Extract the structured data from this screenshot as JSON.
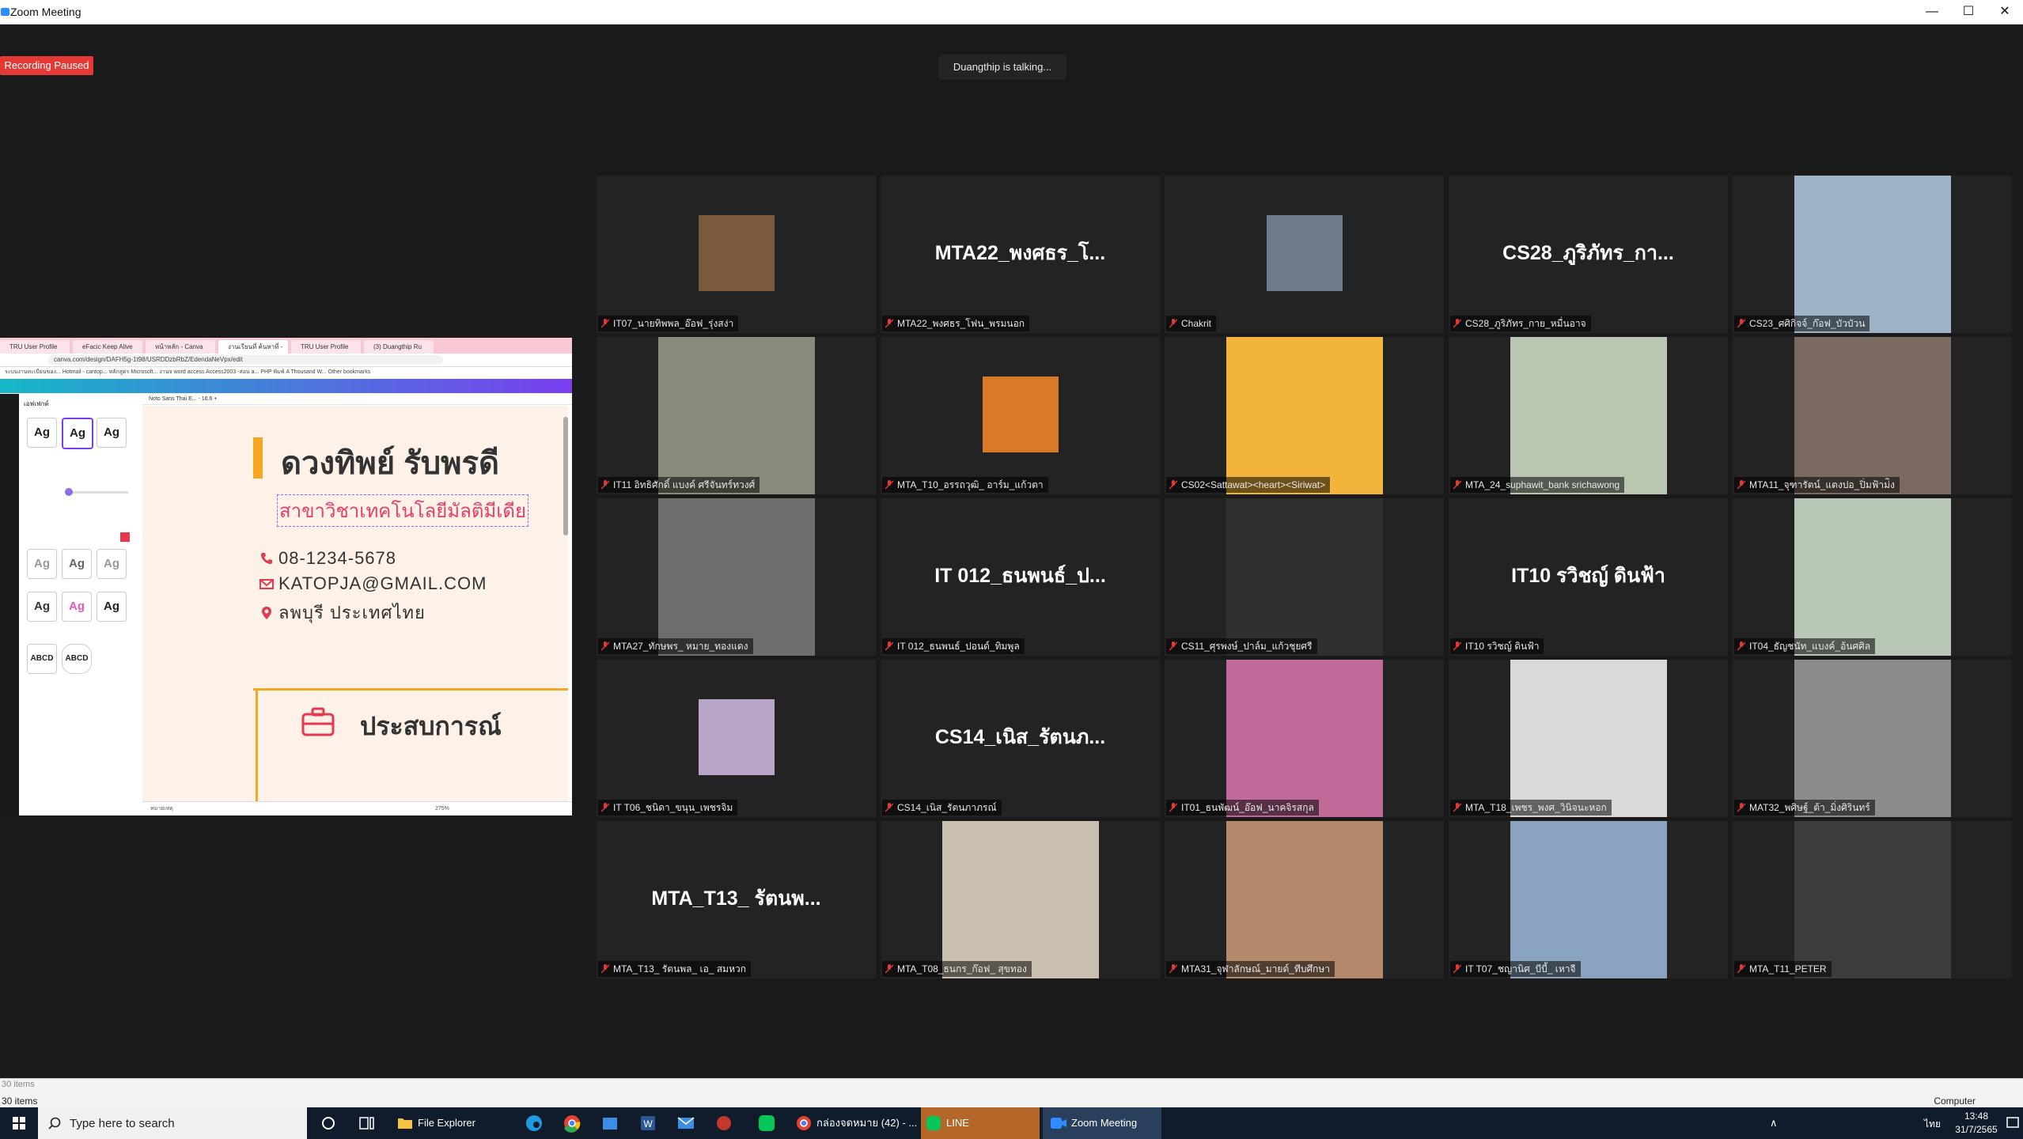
{
  "window": {
    "title": "Zoom Meeting",
    "controls": [
      "—",
      "☐",
      "✕"
    ]
  },
  "meeting": {
    "recording_badge": "Recording Paused",
    "talking_indicator": "Duangthip is talking..."
  },
  "tiles": [
    {
      "display": "",
      "name": "IT07_นายทิพพล_อ๊อฟ_รุ่งสง่า",
      "photo": "#7a5a3c"
    },
    {
      "display": "MTA22_พงศธร_โ...",
      "name": "MTA22_พงศธร_โฟน_พรมนอก",
      "photo": ""
    },
    {
      "display": "",
      "name": "Chakrit",
      "photo": "#6d7b8a"
    },
    {
      "display": "CS28_ภูริภัทร_กา...",
      "name": "CS28_ภูริภัทร_กาย_หมื่นอาจ",
      "photo": ""
    },
    {
      "display": "",
      "name": "CS23_ศศิกิจจ์_ก๊อฟ_บัวบัวน",
      "photo": "#9eb3c8"
    },
    {
      "display": "",
      "name": "IT11 อิทธิศักดิ์ แบงค์ ศรีจันทร์ทวงศ์",
      "photo": "#8a8a7a"
    },
    {
      "display": "",
      "name": "MTA_T10_อรรถวุฒิ_ อาร์ม_แก้วตา",
      "photo": "#d97a2a"
    },
    {
      "display": "",
      "name": "CS02<Sattawat><heart><Siriwat>",
      "photo": "#f2b43a"
    },
    {
      "display": "",
      "name": "MTA_24_suphawit_bank srichawong",
      "photo": "#b9c7b0"
    },
    {
      "display": "",
      "name": "MTA11_จุฑารัตน์_แตงปอ_ปิ่มฟ้าม่ิง",
      "photo": "#7a6a60"
    },
    {
      "display": "",
      "name": "MTA27_ทักษพร_ หมาย_ทองแดง",
      "photo": "#6e6e6e"
    },
    {
      "display": "IT 012_ธนพนธ์_ป...",
      "name": "IT 012_ธนพนธ์_ปอนด์_ทิมพูล",
      "photo": ""
    },
    {
      "display": "",
      "name": "CS11_ศุรพงษ์_ปาล์ม_แก้วชุยศรี",
      "photo": "#2f2f2f"
    },
    {
      "display": "IT10 รวิชญ์ ดินฟ้า",
      "name": "IT10 รวิชญ์ ดินฟ้า",
      "photo": ""
    },
    {
      "display": "",
      "name": "IT04_ธัญชนัท_แบงค์_อ้นศศิล",
      "photo": "#b7c6b5"
    },
    {
      "display": "",
      "name": "IT T06_ชนิดา_ขนุน_เพชรจิม",
      "photo": "#b9a6c8"
    },
    {
      "display": "CS14_เนิส_รัตนภ...",
      "name": "CS14_เนิส_รัตนภาภรณ์",
      "photo": ""
    },
    {
      "display": "",
      "name": "IT01_ธนพัฒน์_อ๊อฟ_นาคจิรสกุล",
      "photo": "#c26a9a"
    },
    {
      "display": "",
      "name": "MTA_T18_เพชร_พงศ_วินิจนะหอก",
      "photo": "#d9d9d9"
    },
    {
      "display": "",
      "name": "MAT32_พศิษฐ์_ต้า_มิ่งศิรินทร์",
      "photo": "#8c8c8c"
    },
    {
      "display": "MTA_T13_ รัตนพ...",
      "name": "MTA_T13_ รัตนพล_ เอ_ สมหวก",
      "photo": ""
    },
    {
      "display": "",
      "name": "MTA_T08_ธนกร_ก๊อฟ_ สุขทอง",
      "photo": "#c9bfae"
    },
    {
      "display": "",
      "name": "MTA31_จุฬาลักษณ์_มายด์_ทีบศึกษา",
      "photo": "#b48a6a"
    },
    {
      "display": "",
      "name": "IT T07_ชญานิศ_บีบี้_ เหาจี",
      "photo": "#8aa3c0"
    },
    {
      "display": "",
      "name": "MTA_T11_PETER",
      "photo": "#3c3c3c"
    }
  ],
  "shared_screen": {
    "tabs": [
      "TRU User Profile",
      "eFacic Keep Alive",
      "หน้าหลัก - Canva",
      "งานเรียนที่ ค้นหาที่ -",
      "TRU User Profile",
      "(3) Duangthip Ru"
    ],
    "url": "canva.com/design/DAFH5g-1t98/USRDDzbRbZ/EdendaNeVpx/edit",
    "bookmarks": "ระบบงานทะเบียนของ...   Hotmail - cantop...   หลักสูตร Microsoft...   งานจ word   access   Access2003 -สอน a...   PHP   พิมพ์ A Thousand W...   Other bookmarks",
    "panel_title": "เอฟเฟกต์",
    "ag_label": "Ag",
    "abcd_label": "ABCD",
    "toolbar_font": "Noto Sans Thai E...   -  16.6  +",
    "canvas": {
      "name": "ดวงทิพย์ รับพรดี",
      "subtitle": "สาขาวิชาเทคโนโลยีมัลติมีเดีย",
      "phone": "08-1234-5678",
      "email": "KATOPJA@GMAIL.COM",
      "location": "ลพบุรี ประเทศไทย",
      "section": "ประสบการณ์"
    },
    "status_left": "หมายเหตุ",
    "zoom": "275%"
  },
  "explorer": {
    "items_top": "30 items",
    "items": "30 items",
    "location": "Computer"
  },
  "taskbar": {
    "search_placeholder": "Type here to search",
    "apps": [
      "File Explorer",
      "กล่องจดหมาย (42) - ...",
      "LINE",
      "Zoom Meeting"
    ],
    "time": "13:48",
    "date": "31/7/2565",
    "lang": "ไทย"
  },
  "colors": {
    "stage": "#1a1a1a",
    "tile": "#232323",
    "record": "#e53935",
    "mute": "#e53935",
    "taskbar": "#101c2c"
  }
}
